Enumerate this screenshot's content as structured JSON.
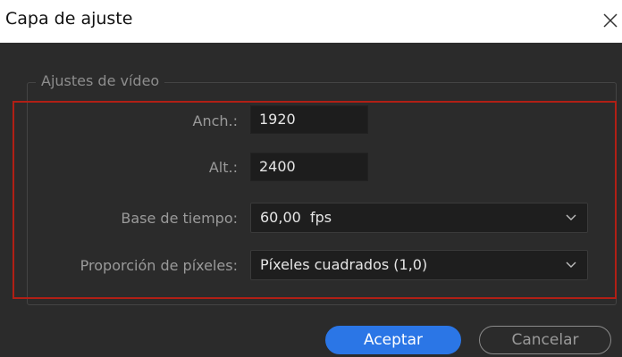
{
  "dialog": {
    "title": "Capa de ajuste",
    "close_icon": "close-icon"
  },
  "video_settings": {
    "legend": "Ajustes de vídeo",
    "width_label": "Anch.:",
    "width_value": "1920",
    "height_label": "Alt.:",
    "height_value": "2400",
    "timebase_label": "Base de tiempo:",
    "timebase_value": "60,00  fps",
    "pixel_aspect_label": "Proporción de píxeles:",
    "pixel_aspect_value": "Píxeles cuadrados (1,0)"
  },
  "buttons": {
    "ok_label": "Aceptar",
    "cancel_label": "Cancelar"
  },
  "colors": {
    "accent": "#2b76e6",
    "highlight_border": "#b11f15",
    "background": "#2b2b2b"
  }
}
